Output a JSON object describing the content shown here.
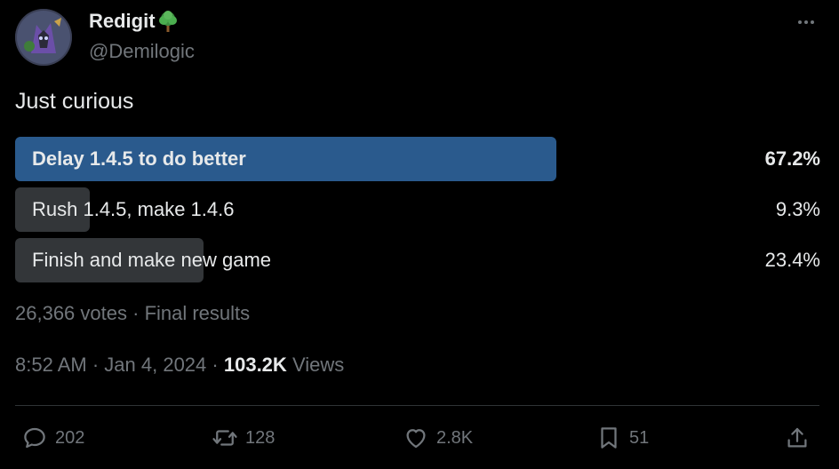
{
  "author": {
    "display_name": "Redigit",
    "badge_icon": "tree-icon",
    "handle": "@Demilogic",
    "avatar_icon": "avatar-image"
  },
  "tweet": {
    "text": "Just curious"
  },
  "poll": {
    "options": [
      {
        "label": "Delay 1.4.5 to do better",
        "percent_text": "67.2%",
        "percent": 67.2,
        "winner": true
      },
      {
        "label": "Rush 1.4.5, make 1.4.6",
        "percent_text": "9.3%",
        "percent": 9.3,
        "winner": false
      },
      {
        "label": "Finish and make new game",
        "percent_text": "23.4%",
        "percent": 23.4,
        "winner": false
      }
    ],
    "votes_text": "26,366 votes",
    "separator": "·",
    "status_text": "Final results"
  },
  "meta": {
    "time": "8:52 AM",
    "separator": "·",
    "date": "Jan 4, 2024",
    "views_count": "103.2K",
    "views_label": "Views"
  },
  "actions": {
    "reply_count": "202",
    "retweet_count": "128",
    "like_count": "2.8K",
    "bookmark_count": "51"
  },
  "colors": {
    "background": "#000000",
    "winner_bar": "#2a5a8d",
    "loser_bar": "#333639",
    "muted_text": "#71767b",
    "primary_text": "#e7e9ea"
  }
}
